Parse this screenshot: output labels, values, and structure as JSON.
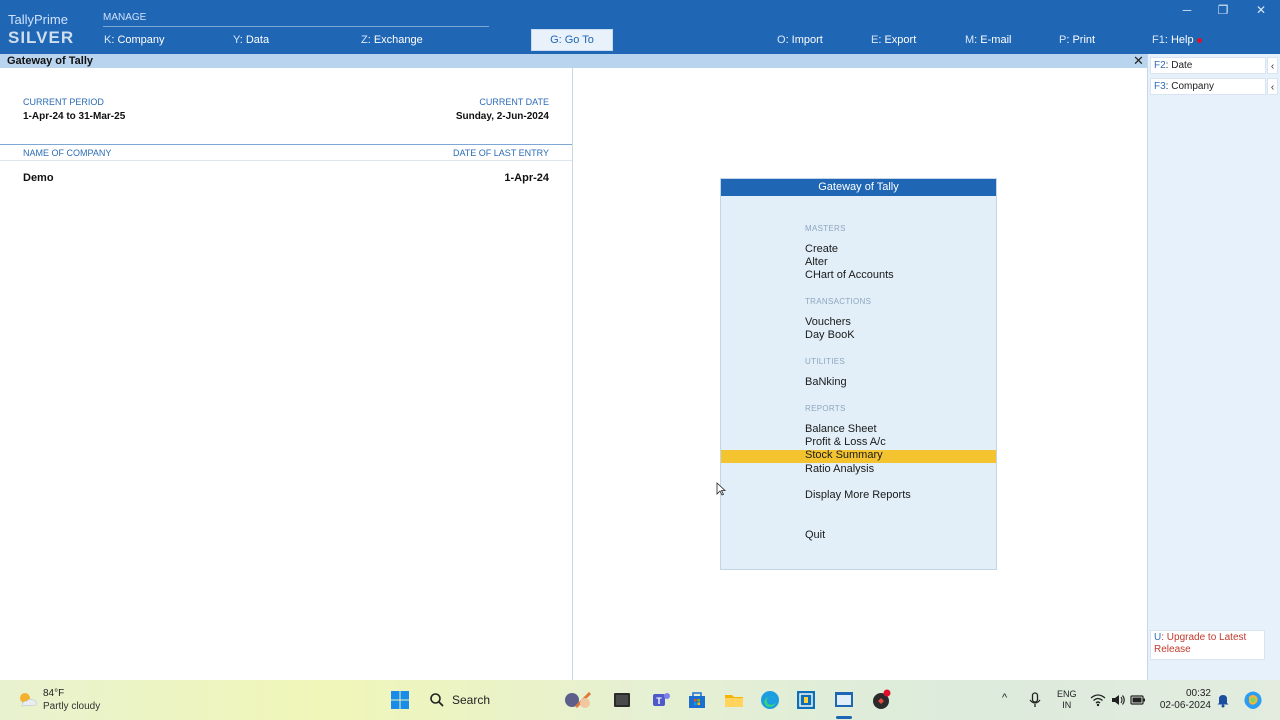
{
  "app": {
    "brand_line1": "TallyPrime",
    "brand_line2": "SILVER"
  },
  "topbar": {
    "manage_label": "MANAGE",
    "menu": [
      {
        "key": "K",
        "label": ": Company"
      },
      {
        "key": "Y",
        "label": ": Data"
      },
      {
        "key": "Z",
        "label": ": Exchange"
      },
      {
        "key": "O",
        "label": ": Import"
      },
      {
        "key": "E",
        "label": ": Export"
      },
      {
        "key": "M",
        "label": ": E-mail"
      },
      {
        "key": "P",
        "label": ": Print"
      },
      {
        "key": "F1",
        "label": ": Help"
      }
    ],
    "goto": {
      "key": "G",
      "label": ": Go To"
    },
    "window_controls": [
      "minimize-icon",
      "restore-icon",
      "close-icon"
    ]
  },
  "screen": {
    "title": "Gateway of Tally",
    "current_period_label": "CURRENT PERIOD",
    "current_period_value": "1-Apr-24 to 31-Mar-25",
    "current_date_label": "CURRENT DATE",
    "current_date_value": "Sunday, 2-Jun-2024",
    "company_col_label": "NAME OF COMPANY",
    "last_entry_col_label": "DATE OF LAST ENTRY",
    "companies": [
      {
        "name": "Demo",
        "last_entry": "1-Apr-24"
      }
    ]
  },
  "sidebar": {
    "buttons": [
      {
        "key": "F2",
        "label": ": Date"
      },
      {
        "key": "F3",
        "label": ": Company"
      }
    ],
    "arrow": "‹",
    "upgrade": {
      "key": "U",
      "label": ": Upgrade to Latest Release"
    }
  },
  "gateway": {
    "title": "Gateway of Tally",
    "sections": {
      "masters": "MASTERS",
      "transactions": "TRANSACTIONS",
      "utilities": "UTILITIES",
      "reports": "REPORTS"
    },
    "items": {
      "create": "Create",
      "alter": "Alter",
      "chart": "CHart of Accounts",
      "vouchers": "Vouchers",
      "daybook": "Day BooK",
      "banking": "BaNking",
      "balance_sheet": "Balance Sheet",
      "pl": "Profit & Loss A/c",
      "stock_summary": "Stock Summary",
      "ratio": "Ratio Analysis",
      "more_reports": "Display More Reports",
      "quit": "Quit"
    },
    "highlighted": "Stock Summary"
  },
  "taskbar": {
    "weather_temp": "84°F",
    "weather_desc": "Partly cloudy",
    "search_placeholder": "Search",
    "lang_line1": "ENG",
    "lang_line2": "IN",
    "time": "00:32",
    "date": "02-06-2024"
  },
  "colors": {
    "brand_blue": "#1f66b4",
    "highlight": "#f4c430",
    "panel_bg": "#e2eff8"
  }
}
